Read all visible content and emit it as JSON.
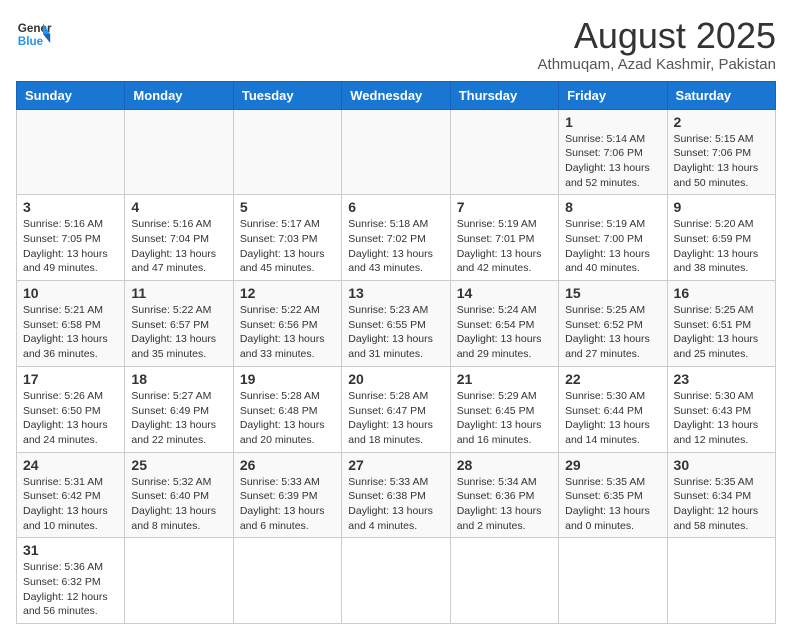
{
  "header": {
    "logo_general": "General",
    "logo_blue": "Blue",
    "title": "August 2025",
    "subtitle": "Athmuqam, Azad Kashmir, Pakistan"
  },
  "weekdays": [
    "Sunday",
    "Monday",
    "Tuesday",
    "Wednesday",
    "Thursday",
    "Friday",
    "Saturday"
  ],
  "weeks": [
    [
      {
        "day": "",
        "info": ""
      },
      {
        "day": "",
        "info": ""
      },
      {
        "day": "",
        "info": ""
      },
      {
        "day": "",
        "info": ""
      },
      {
        "day": "",
        "info": ""
      },
      {
        "day": "1",
        "info": "Sunrise: 5:14 AM\nSunset: 7:06 PM\nDaylight: 13 hours and 52 minutes."
      },
      {
        "day": "2",
        "info": "Sunrise: 5:15 AM\nSunset: 7:06 PM\nDaylight: 13 hours and 50 minutes."
      }
    ],
    [
      {
        "day": "3",
        "info": "Sunrise: 5:16 AM\nSunset: 7:05 PM\nDaylight: 13 hours and 49 minutes."
      },
      {
        "day": "4",
        "info": "Sunrise: 5:16 AM\nSunset: 7:04 PM\nDaylight: 13 hours and 47 minutes."
      },
      {
        "day": "5",
        "info": "Sunrise: 5:17 AM\nSunset: 7:03 PM\nDaylight: 13 hours and 45 minutes."
      },
      {
        "day": "6",
        "info": "Sunrise: 5:18 AM\nSunset: 7:02 PM\nDaylight: 13 hours and 43 minutes."
      },
      {
        "day": "7",
        "info": "Sunrise: 5:19 AM\nSunset: 7:01 PM\nDaylight: 13 hours and 42 minutes."
      },
      {
        "day": "8",
        "info": "Sunrise: 5:19 AM\nSunset: 7:00 PM\nDaylight: 13 hours and 40 minutes."
      },
      {
        "day": "9",
        "info": "Sunrise: 5:20 AM\nSunset: 6:59 PM\nDaylight: 13 hours and 38 minutes."
      }
    ],
    [
      {
        "day": "10",
        "info": "Sunrise: 5:21 AM\nSunset: 6:58 PM\nDaylight: 13 hours and 36 minutes."
      },
      {
        "day": "11",
        "info": "Sunrise: 5:22 AM\nSunset: 6:57 PM\nDaylight: 13 hours and 35 minutes."
      },
      {
        "day": "12",
        "info": "Sunrise: 5:22 AM\nSunset: 6:56 PM\nDaylight: 13 hours and 33 minutes."
      },
      {
        "day": "13",
        "info": "Sunrise: 5:23 AM\nSunset: 6:55 PM\nDaylight: 13 hours and 31 minutes."
      },
      {
        "day": "14",
        "info": "Sunrise: 5:24 AM\nSunset: 6:54 PM\nDaylight: 13 hours and 29 minutes."
      },
      {
        "day": "15",
        "info": "Sunrise: 5:25 AM\nSunset: 6:52 PM\nDaylight: 13 hours and 27 minutes."
      },
      {
        "day": "16",
        "info": "Sunrise: 5:25 AM\nSunset: 6:51 PM\nDaylight: 13 hours and 25 minutes."
      }
    ],
    [
      {
        "day": "17",
        "info": "Sunrise: 5:26 AM\nSunset: 6:50 PM\nDaylight: 13 hours and 24 minutes."
      },
      {
        "day": "18",
        "info": "Sunrise: 5:27 AM\nSunset: 6:49 PM\nDaylight: 13 hours and 22 minutes."
      },
      {
        "day": "19",
        "info": "Sunrise: 5:28 AM\nSunset: 6:48 PM\nDaylight: 13 hours and 20 minutes."
      },
      {
        "day": "20",
        "info": "Sunrise: 5:28 AM\nSunset: 6:47 PM\nDaylight: 13 hours and 18 minutes."
      },
      {
        "day": "21",
        "info": "Sunrise: 5:29 AM\nSunset: 6:45 PM\nDaylight: 13 hours and 16 minutes."
      },
      {
        "day": "22",
        "info": "Sunrise: 5:30 AM\nSunset: 6:44 PM\nDaylight: 13 hours and 14 minutes."
      },
      {
        "day": "23",
        "info": "Sunrise: 5:30 AM\nSunset: 6:43 PM\nDaylight: 13 hours and 12 minutes."
      }
    ],
    [
      {
        "day": "24",
        "info": "Sunrise: 5:31 AM\nSunset: 6:42 PM\nDaylight: 13 hours and 10 minutes."
      },
      {
        "day": "25",
        "info": "Sunrise: 5:32 AM\nSunset: 6:40 PM\nDaylight: 13 hours and 8 minutes."
      },
      {
        "day": "26",
        "info": "Sunrise: 5:33 AM\nSunset: 6:39 PM\nDaylight: 13 hours and 6 minutes."
      },
      {
        "day": "27",
        "info": "Sunrise: 5:33 AM\nSunset: 6:38 PM\nDaylight: 13 hours and 4 minutes."
      },
      {
        "day": "28",
        "info": "Sunrise: 5:34 AM\nSunset: 6:36 PM\nDaylight: 13 hours and 2 minutes."
      },
      {
        "day": "29",
        "info": "Sunrise: 5:35 AM\nSunset: 6:35 PM\nDaylight: 13 hours and 0 minutes."
      },
      {
        "day": "30",
        "info": "Sunrise: 5:35 AM\nSunset: 6:34 PM\nDaylight: 12 hours and 58 minutes."
      }
    ],
    [
      {
        "day": "31",
        "info": "Sunrise: 5:36 AM\nSunset: 6:32 PM\nDaylight: 12 hours and 56 minutes."
      },
      {
        "day": "",
        "info": ""
      },
      {
        "day": "",
        "info": ""
      },
      {
        "day": "",
        "info": ""
      },
      {
        "day": "",
        "info": ""
      },
      {
        "day": "",
        "info": ""
      },
      {
        "day": "",
        "info": ""
      }
    ]
  ]
}
